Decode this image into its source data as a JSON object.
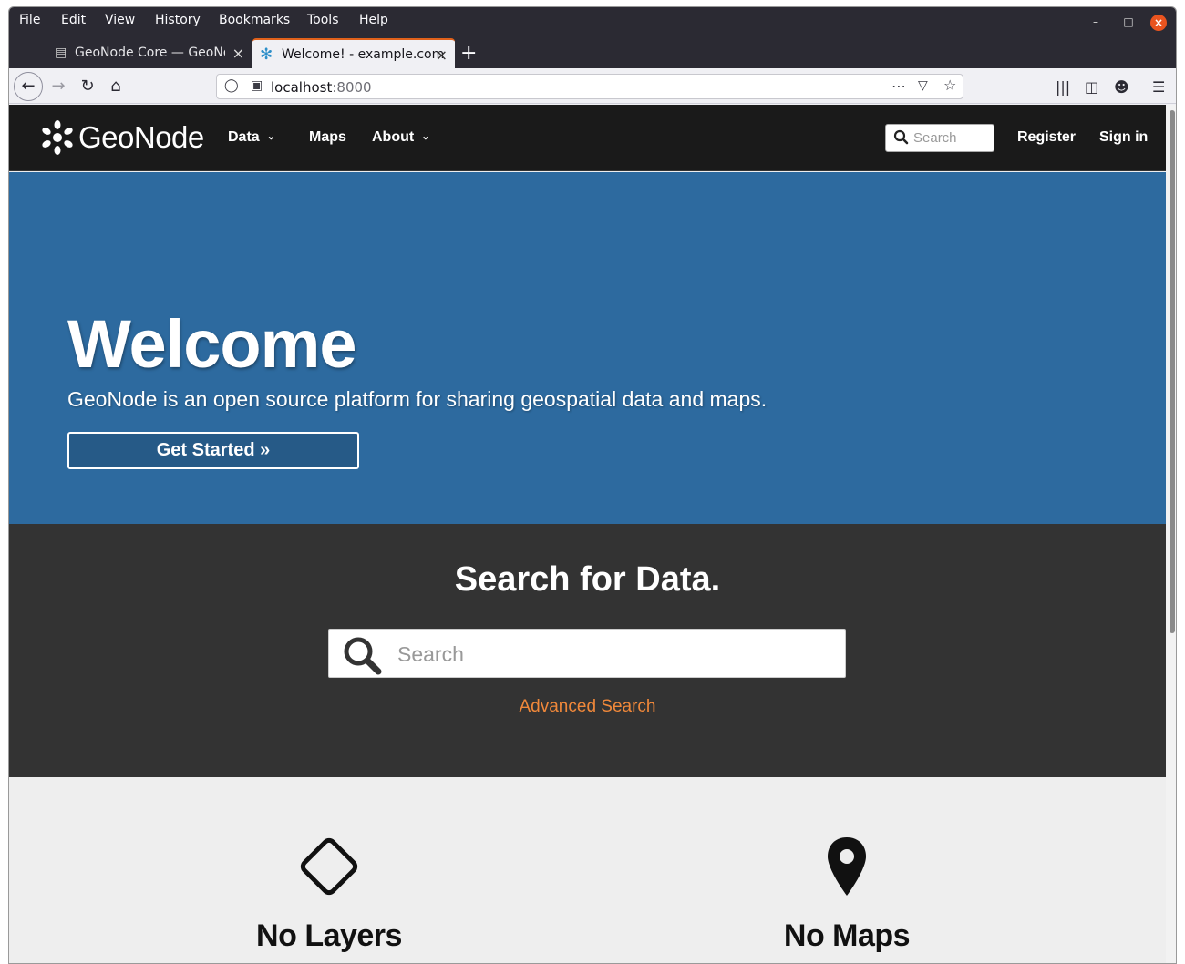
{
  "browser": {
    "menu": [
      "File",
      "Edit",
      "View",
      "History",
      "Bookmarks",
      "Tools",
      "Help"
    ],
    "tabs": [
      {
        "title": "GeoNode Core — GeoNode",
        "active": false
      },
      {
        "title": "Welcome! - example.com",
        "active": true
      }
    ],
    "url_host": "localhost",
    "url_port": ":8000",
    "accent_color": "#e0611b"
  },
  "site_nav": {
    "logo_text": "GeoNode",
    "links": [
      "Data",
      "Maps",
      "About"
    ],
    "search_placeholder": "Search",
    "register": "Register",
    "sign_in": "Sign in"
  },
  "hero": {
    "title": "Welcome",
    "subtitle": "GeoNode is an open source platform for sharing geospatial data and maps.",
    "button": "Get Started »",
    "bg_color": "#2d6a9f"
  },
  "search_section": {
    "title": "Search for Data.",
    "placeholder": "Search",
    "advanced_link": "Advanced Search",
    "link_color": "#f0883a"
  },
  "stats": [
    {
      "label": "No Layers",
      "icon": "diamond-icon"
    },
    {
      "label": "No Maps",
      "icon": "map-marker-icon"
    }
  ]
}
